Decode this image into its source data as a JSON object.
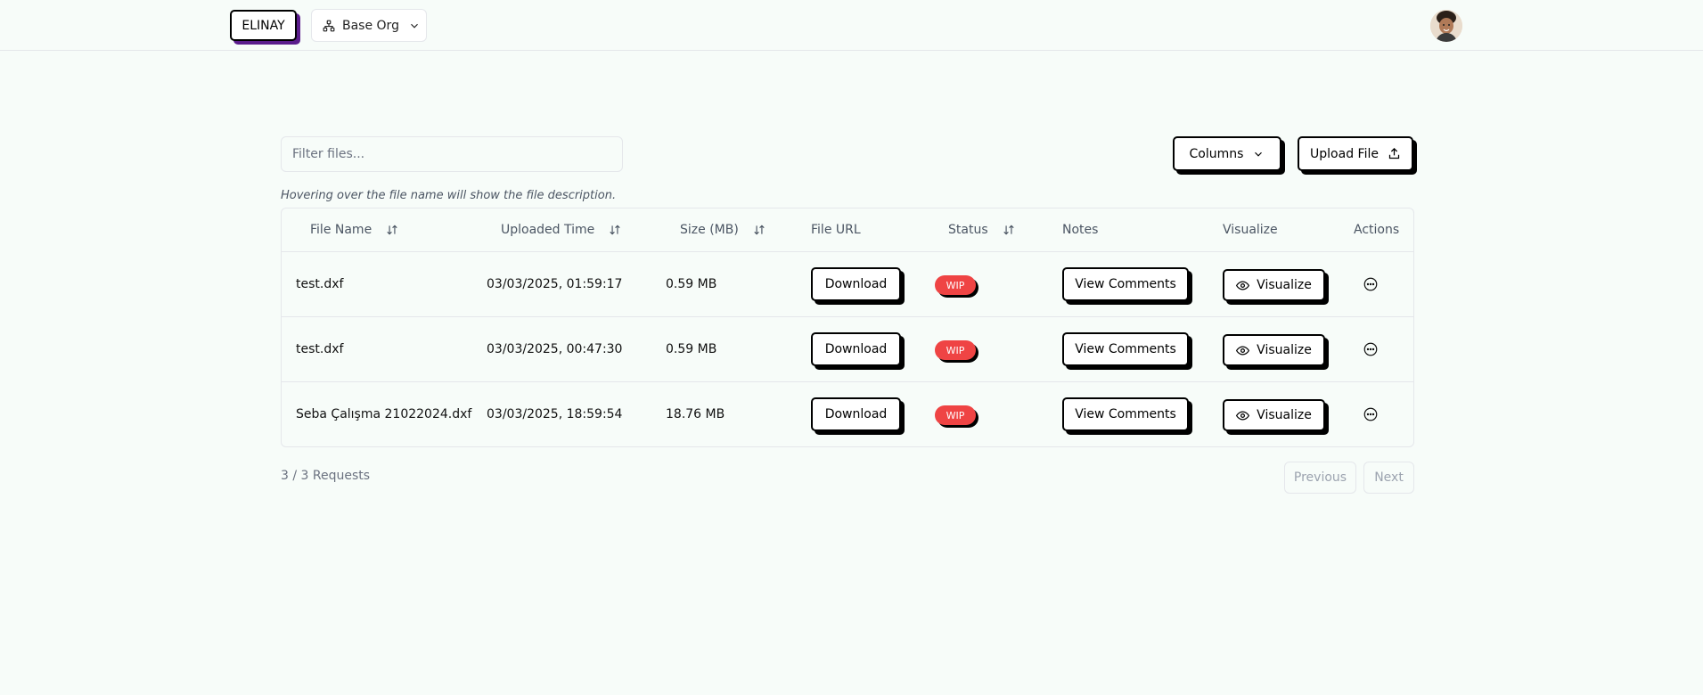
{
  "header": {
    "logo": "ELINAY",
    "org_selector": "Base Org",
    "icons": {
      "org": "org-tree-icon",
      "chevron": "chevron-down-icon",
      "avatar": "user-avatar"
    }
  },
  "toolbar": {
    "filter_placeholder": "Filter files...",
    "columns_label": "Columns",
    "upload_label": "Upload File"
  },
  "hint": "Hovering over the file name will show the file description.",
  "table": {
    "headers": {
      "file_name": "File Name",
      "uploaded_time": "Uploaded Time",
      "size": "Size (MB)",
      "file_url": "File URL",
      "status": "Status",
      "notes": "Notes",
      "visualize": "Visualize",
      "actions": "Actions"
    },
    "rows": [
      {
        "name": "test.dxf",
        "time": "03/03/2025, 01:59:17",
        "size": "0.59 MB",
        "download": "Download",
        "status": "WIP",
        "comments": "View Comments",
        "visualize": "Visualize"
      },
      {
        "name": "test.dxf",
        "time": "03/03/2025, 00:47:30",
        "size": "0.59 MB",
        "download": "Download",
        "status": "WIP",
        "comments": "View Comments",
        "visualize": "Visualize"
      },
      {
        "name": "Seba Çalışma 21022024.dxf",
        "time": "03/03/2025, 18:59:54",
        "size": "18.76 MB",
        "download": "Download",
        "status": "WIP",
        "comments": "View Comments",
        "visualize": "Visualize"
      }
    ]
  },
  "footer": {
    "count": "3 / 3 Requests",
    "previous": "Previous",
    "next": "Next"
  },
  "colors": {
    "background": "#f7fcf9",
    "status_wip": "#ef4444",
    "logo_shadow": "#5b1d8c"
  }
}
